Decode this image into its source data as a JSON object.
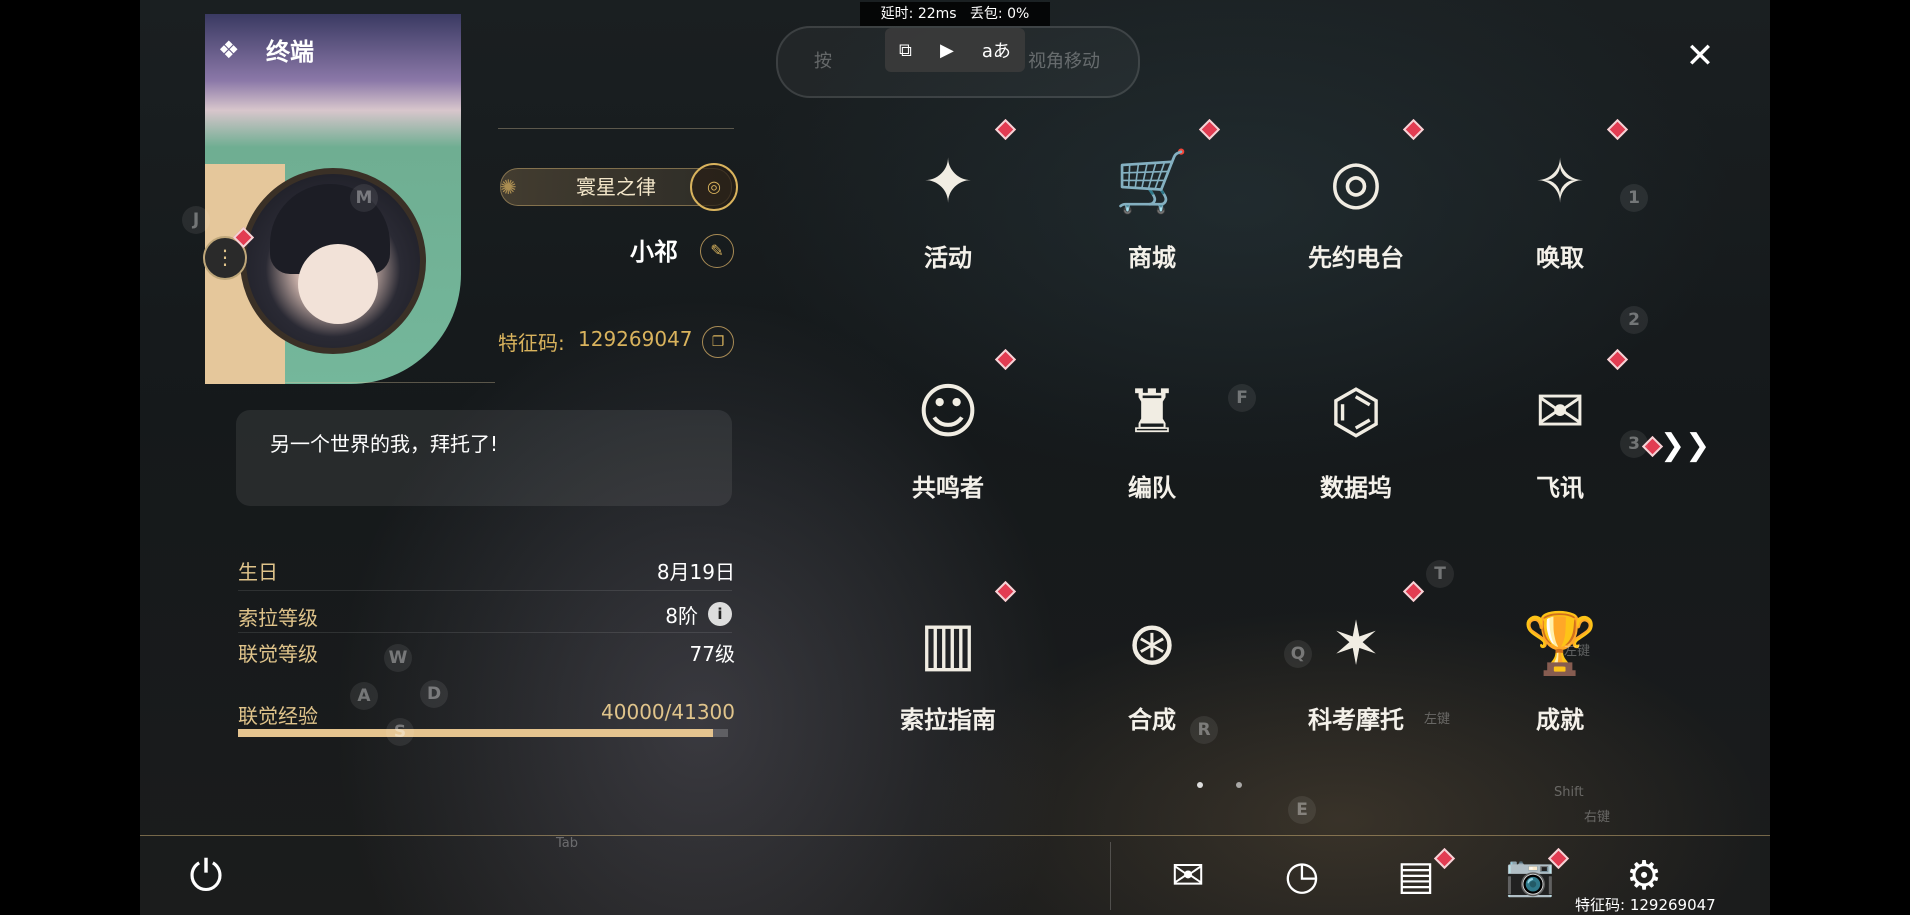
{
  "network": {
    "latency": "延时: 22ms",
    "packet_loss": "丢包: 0%"
  },
  "hint_pill": {
    "prefix": "按",
    "suffix": "视角移动"
  },
  "overlay_icons": [
    "screen-toggle-icon",
    "record-icon",
    "translate-icon"
  ],
  "overlay_translate": "aあ",
  "terminal": {
    "title": "终端"
  },
  "profile": {
    "title_badge": "寰星之律",
    "username": "小祁",
    "uid_label": "特征码:",
    "uid_value": "129269047",
    "signature": "另一个世界的我，拜托了!",
    "stats": [
      {
        "label": "生日",
        "value": "8月19日"
      },
      {
        "label": "索拉等级",
        "value": "8阶"
      },
      {
        "label": "联觉等级",
        "value": "77级"
      },
      {
        "label": "联觉经验",
        "value": "40000/41300"
      }
    ],
    "exp_fraction": 0.9685
  },
  "menu": [
    {
      "label": "活动",
      "icon": "activity-icon",
      "glyph": "✦",
      "badge": true
    },
    {
      "label": "商城",
      "icon": "shop-icon",
      "glyph": "🛒",
      "badge": true
    },
    {
      "label": "先约电台",
      "icon": "radio-icon",
      "glyph": "◎",
      "badge": true
    },
    {
      "label": "唤取",
      "icon": "convene-icon",
      "glyph": "✧",
      "badge": true
    },
    {
      "label": "共鸣者",
      "icon": "resonator-icon",
      "glyph": "☺",
      "badge": true
    },
    {
      "label": "编队",
      "icon": "team-icon",
      "glyph": "♜",
      "badge": false
    },
    {
      "label": "数据坞",
      "icon": "databank-icon",
      "glyph": "⌬",
      "badge": false
    },
    {
      "label": "飞讯",
      "icon": "message-icon",
      "glyph": "✉",
      "badge": true
    },
    {
      "label": "索拉指南",
      "icon": "guide-icon",
      "glyph": "▥",
      "badge": true
    },
    {
      "label": "合成",
      "icon": "synthesis-icon",
      "glyph": "⊛",
      "badge": false
    },
    {
      "label": "科考摩托",
      "icon": "motorbike-icon",
      "glyph": "✶",
      "badge": true
    },
    {
      "label": "成就",
      "icon": "achievement-icon",
      "glyph": "🏆",
      "badge": false
    }
  ],
  "key_hints": [
    "1",
    "2",
    "3",
    "F",
    "T",
    "Q",
    "R",
    "E",
    "W",
    "A",
    "S",
    "D",
    "J",
    "M"
  ],
  "key_hint_texts": [
    "左键",
    "Shift",
    "右键",
    "左键",
    "Tab"
  ],
  "bottom": {
    "uid": "特征码: 129269047"
  },
  "colors": {
    "accent_gold": "#d9b35d",
    "badge_red": "#e23c52"
  }
}
